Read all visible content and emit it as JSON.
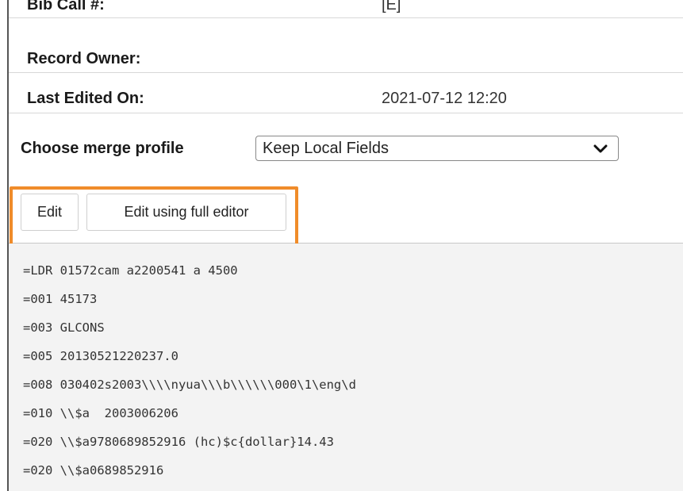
{
  "record_info": {
    "rows": [
      {
        "label": "Bib Call #:",
        "value": "[E]"
      },
      {
        "label": "Record Owner:",
        "value": ""
      },
      {
        "label": "Last Edited On:",
        "value": "2021-07-12 12:20"
      }
    ]
  },
  "merge": {
    "label": "Choose merge profile",
    "selected": "Keep Local Fields"
  },
  "toolbar": {
    "edit_label": "Edit",
    "full_editor_label": "Edit using full editor",
    "highlight_color": "#f08c2a"
  },
  "marc_record": {
    "lines": [
      "=LDR 01572cam a2200541 a 4500",
      "=001 45173",
      "=003 GLCONS",
      "=005 20130521220237.0",
      "=008 030402s2003\\\\\\\\nyua\\\\\\b\\\\\\\\\\\\000\\1\\eng\\d",
      "=010 \\\\$a  2003006206",
      "=020 \\\\$a9780689852916 (hc)$c{dollar}14.43",
      "=020 \\\\$a0689852916"
    ]
  }
}
